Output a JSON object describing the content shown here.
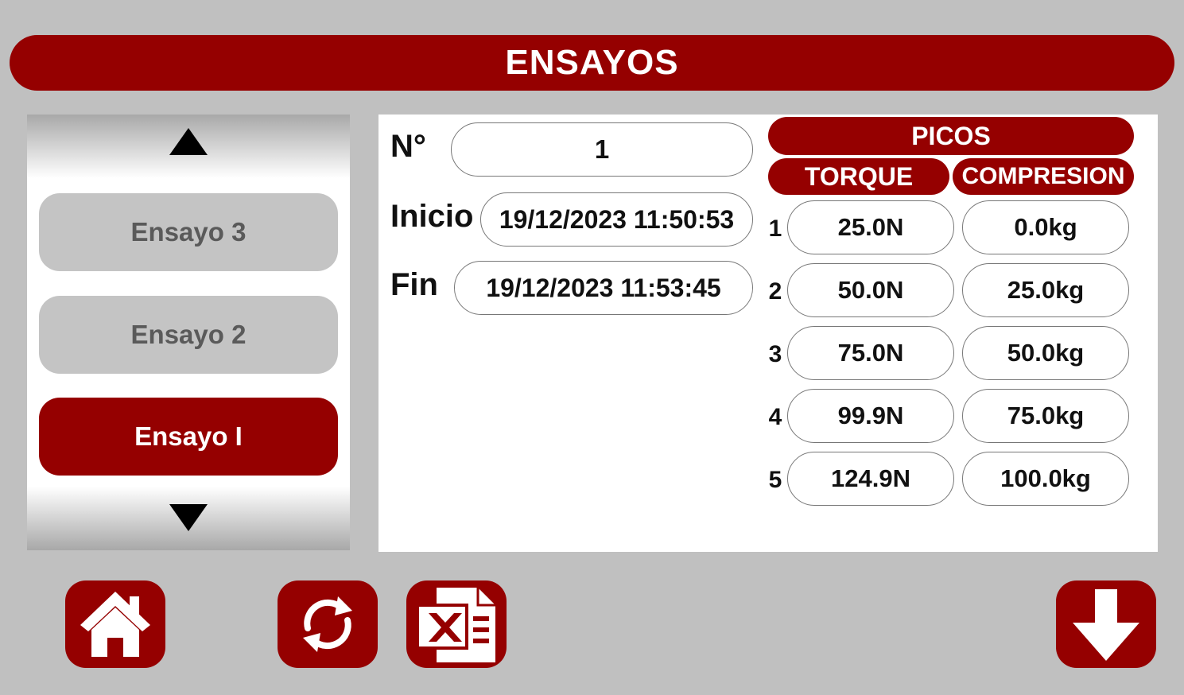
{
  "header": {
    "title": "ENSAYOS"
  },
  "list": {
    "items": [
      {
        "label": "Ensayo 3",
        "state": "inactive"
      },
      {
        "label": "Ensayo 2",
        "state": "inactive"
      },
      {
        "label": "Ensayo I",
        "state": "active"
      }
    ]
  },
  "detail": {
    "number_label": "N°",
    "number_value": "1",
    "start_label": "Inicio",
    "start_value": "19/12/2023 11:50:53",
    "end_label": "Fin",
    "end_value": "19/12/2023 11:53:45"
  },
  "peaks": {
    "title": "PICOS",
    "torque_header": "TORQUE",
    "compression_header": "COMPRESION",
    "rows": [
      {
        "n": "1",
        "torque": "25.0N",
        "compression": "0.0kg"
      },
      {
        "n": "2",
        "torque": "50.0N",
        "compression": "25.0kg"
      },
      {
        "n": "3",
        "torque": "75.0N",
        "compression": "50.0kg"
      },
      {
        "n": "4",
        "torque": "99.9N",
        "compression": "75.0kg"
      },
      {
        "n": "5",
        "torque": "124.9N",
        "compression": "100.0kg"
      }
    ]
  },
  "toolbar": {
    "icons": [
      "home-icon",
      "refresh-icon",
      "excel-icon",
      "download-icon"
    ]
  },
  "colors": {
    "accent": "#950000",
    "background": "#c0c0c0",
    "inactive_item": "#c4c4c4"
  }
}
